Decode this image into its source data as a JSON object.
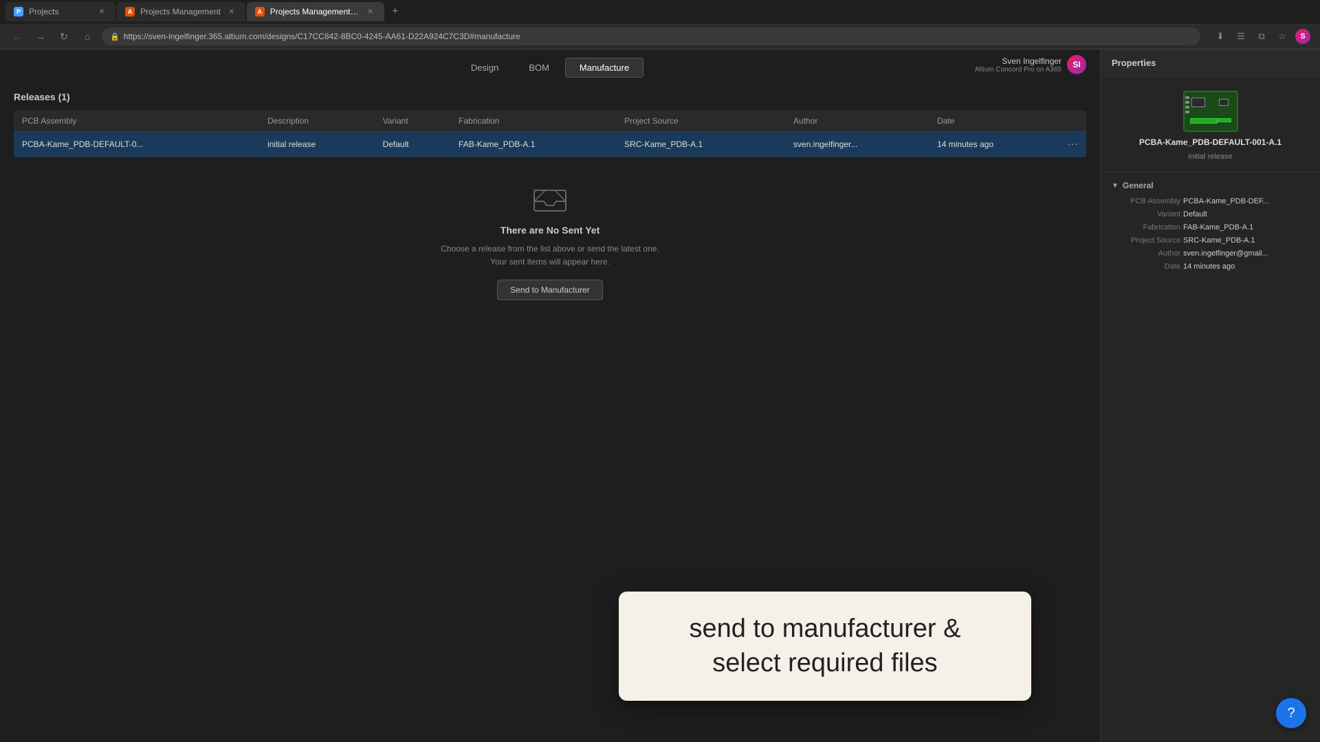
{
  "browser": {
    "tabs": [
      {
        "label": "Projects",
        "favicon": "P",
        "active": false,
        "id": "tab-projects"
      },
      {
        "label": "Projects Management",
        "favicon": "A",
        "active": false,
        "id": "tab-projects-mgmt"
      },
      {
        "label": "Projects Management - Manu...",
        "favicon": "A",
        "active": true,
        "id": "tab-projects-mgmt-manu"
      }
    ],
    "url": "https://sven-ingelfinger.365.altium.com/designs/C17CC842-8BC0-4245-AA61-D22A924C7C3D#manufacture",
    "actions": [
      "⬇",
      "☰",
      "⧉",
      "★",
      "👤"
    ]
  },
  "nav": {
    "tabs": [
      {
        "label": "Design",
        "active": false
      },
      {
        "label": "BOM",
        "active": false
      },
      {
        "label": "Manufacture",
        "active": true
      }
    ]
  },
  "releases": {
    "title": "Releases (1)",
    "columns": [
      "PCB Assembly",
      "Description",
      "Variant",
      "Fabrication",
      "Project Source",
      "Author",
      "Date"
    ],
    "rows": [
      {
        "pcb_assembly": "PCBA-Kame_PDB-DEFAULT-0...",
        "description": "initial release",
        "variant": "Default",
        "fabrication": "FAB-Kame_PDB-A.1",
        "project_source": "SRC-Kame_PDB-A.1",
        "author": "sven.ingelfinger...",
        "date": "14 minutes ago",
        "selected": true
      }
    ]
  },
  "empty_state": {
    "title": "There are No Sent Yet",
    "description": "Choose a release from the list above or send the latest one.\nYour sent items will appear here.",
    "button_label": "Send to Manufacturer"
  },
  "right_panel": {
    "header": "Properties",
    "preview_name": "PCBA-Kame_PDB-DEFAULT-001-A.1",
    "preview_desc": "initial release",
    "section": {
      "title": "General",
      "props": [
        {
          "label": "PCB Assembly",
          "value": "PCBA-Kame_PDB-DEF..."
        },
        {
          "label": "Variant",
          "value": "Default"
        },
        {
          "label": "Fabrication",
          "value": "FAB-Kame_PDB-A.1"
        },
        {
          "label": "Project Source",
          "value": "SRC-Kame_PDB-A.1"
        },
        {
          "label": "Author",
          "value": "sven.ingelfinger@gmail..."
        },
        {
          "label": "Date",
          "value": "14 minutes ago"
        }
      ]
    }
  },
  "user": {
    "name": "Sven Ingelfinger",
    "subtitle": "Altium Concord Pro on A365",
    "avatar_initials": "SI"
  },
  "tooltip": {
    "text": "send to manufacturer &\nselect required files"
  },
  "support_btn": "?"
}
